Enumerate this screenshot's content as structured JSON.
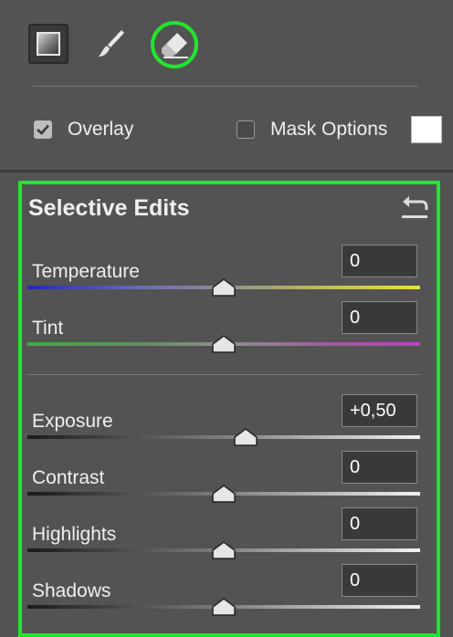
{
  "tools": {
    "gradient": "linear-gradient-tool",
    "brush": "brush-tool",
    "eraser": "eraser-tool",
    "eraser_highlight": "#1fe62d"
  },
  "options": {
    "overlay_label": "Overlay",
    "overlay_checked": true,
    "mask_options_label": "Mask Options",
    "mask_options_checked": false,
    "mask_color": "#ffffff"
  },
  "selective_edits": {
    "title": "Selective Edits",
    "highlight_color": "#1fe62d",
    "sliders": [
      {
        "label": "Temperature",
        "value": "0",
        "position": 0.5
      },
      {
        "label": "Tint",
        "value": "0",
        "position": 0.5
      },
      {
        "label": "Exposure",
        "value": "+0,50",
        "position": 0.556
      },
      {
        "label": "Contrast",
        "value": "0",
        "position": 0.5
      },
      {
        "label": "Highlights",
        "value": "0",
        "position": 0.5
      },
      {
        "label": "Shadows",
        "value": "0",
        "position": 0.5
      }
    ]
  }
}
